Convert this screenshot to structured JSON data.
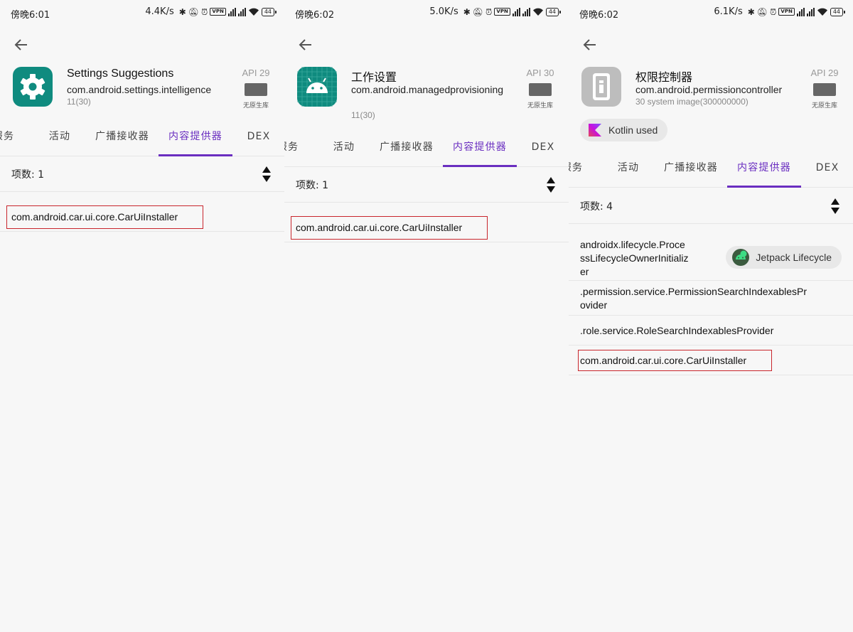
{
  "status_icons": [
    "bluetooth-icon",
    "mute-icon",
    "alarm-icon",
    "vpn-icon",
    "signal-icon",
    "wifi-icon",
    "battery-icon"
  ],
  "colors": {
    "accent": "#6a2ec0",
    "highlight": "#c8252c",
    "teal_icon": "#0f8b7f",
    "grey_icon": "#bdbdbd"
  },
  "screens": [
    {
      "status": {
        "time": "傍晚6:01",
        "speed": "4.4K/s",
        "vpn": "VPN",
        "battery": "44"
      },
      "app": {
        "name": "Settings Suggestions",
        "package": "com.android.settings.intelligence",
        "version": "11(30)",
        "icon": "gear-icon"
      },
      "api": {
        "label": "API 29",
        "sub": "无原生库"
      },
      "tabs": [
        "服务",
        "活动",
        "广播接收器",
        "内容提供器",
        "DEX"
      ],
      "active_tab": "内容提供器",
      "count": {
        "label": "项数:",
        "value": "1"
      },
      "rows": [
        {
          "text": "com.android.car.ui.core.CarUiInstaller"
        }
      ]
    },
    {
      "status": {
        "time": "傍晚6:02",
        "speed": "5.0K/s",
        "vpn": "VPN",
        "battery": "44"
      },
      "app": {
        "name": "工作设置",
        "package": "com.android.managedprovisioning",
        "version": "11(30)",
        "icon": "android-icon"
      },
      "api": {
        "label": "API 30",
        "sub": "无原生库"
      },
      "tabs": [
        "服务",
        "活动",
        "广播接收器",
        "内容提供器",
        "DEX"
      ],
      "active_tab": "内容提供器",
      "count": {
        "label": "项数:",
        "value": "1"
      },
      "rows": [
        {
          "text": "com.android.car.ui.core.CarUiInstaller"
        }
      ]
    },
    {
      "status": {
        "time": "傍晚6:02",
        "speed": "6.1K/s",
        "vpn": "VPN",
        "battery": "44"
      },
      "app": {
        "name": "权限控制器",
        "package": "com.android.permissioncontroller",
        "version": "30 system image(300000000)",
        "icon": "info-icon"
      },
      "api": {
        "label": "API 29",
        "sub": "无原生库"
      },
      "kotlin": "Kotlin used",
      "tabs": [
        "服务",
        "活动",
        "广播接收器",
        "内容提供器",
        "DEX"
      ],
      "active_tab": "内容提供器",
      "count": {
        "label": "项数:",
        "value": "4"
      },
      "rows": [
        {
          "text": "androidx.lifecycle.ProcessLifecycleOwnerInitializer",
          "lines": [
            "androidx.lifecycle.Proce",
            "ssLifecycleOwnerInitializ",
            "er"
          ],
          "lib": "Jetpack Lifecycle"
        },
        {
          "text": ".permission.service.PermissionSearchIndexablesProvider",
          "lines": [
            ".permission.service.PermissionSearchIndexablesPr",
            "ovider"
          ]
        },
        {
          "text": ".role.service.RoleSearchIndexablesProvider"
        },
        {
          "text": "com.android.car.ui.core.CarUiInstaller"
        }
      ]
    }
  ]
}
